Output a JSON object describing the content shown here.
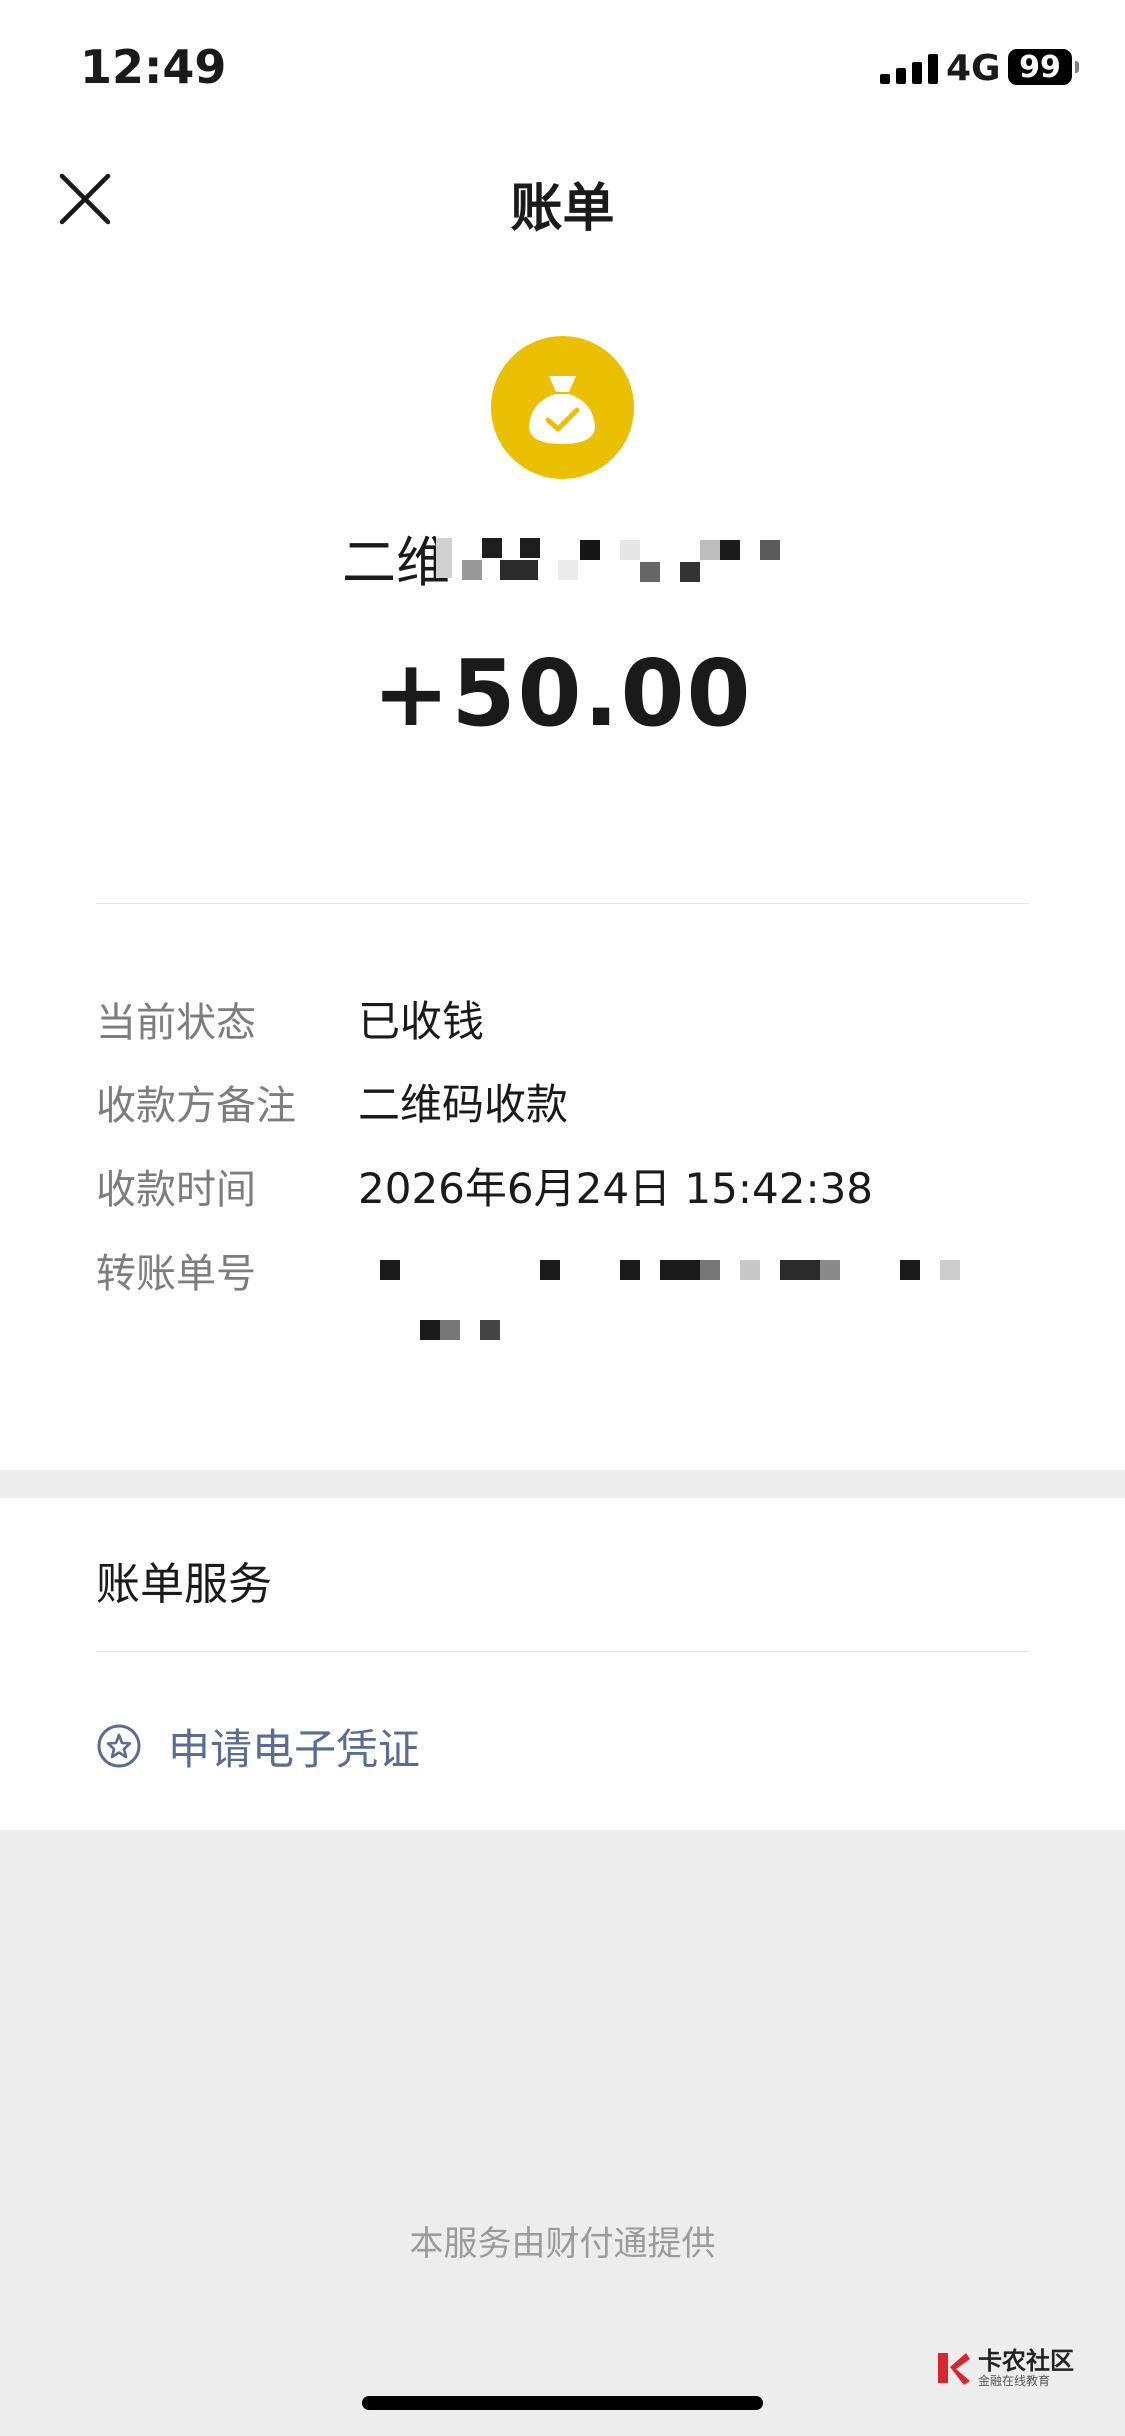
{
  "status_bar": {
    "time": "12:49",
    "network": "4G",
    "battery": "99"
  },
  "header": {
    "title": "账单"
  },
  "transaction": {
    "icon": "money-bag-check-icon",
    "merchant_prefix": "二维",
    "amount": "+50.00"
  },
  "details": [
    {
      "label": "当前状态",
      "value": "已收钱"
    },
    {
      "label": "收款方备注",
      "value": "二维码收款"
    },
    {
      "label": "收款时间",
      "value": "2026年6月24日 15:42:38"
    },
    {
      "label": "转账单号",
      "value": ""
    }
  ],
  "services": {
    "title": "账单服务",
    "items": [
      {
        "label": "申请电子凭证",
        "icon": "star-circle-icon"
      }
    ]
  },
  "footer": {
    "note": "本服务由财付通提供"
  },
  "watermark": {
    "brand": "卡农社区",
    "tagline": "金融在线教育"
  },
  "colors": {
    "icon_yellow": "#eac000",
    "link_blue": "#586c94",
    "label_gray": "#7d7d7d",
    "background": "#ededed"
  }
}
